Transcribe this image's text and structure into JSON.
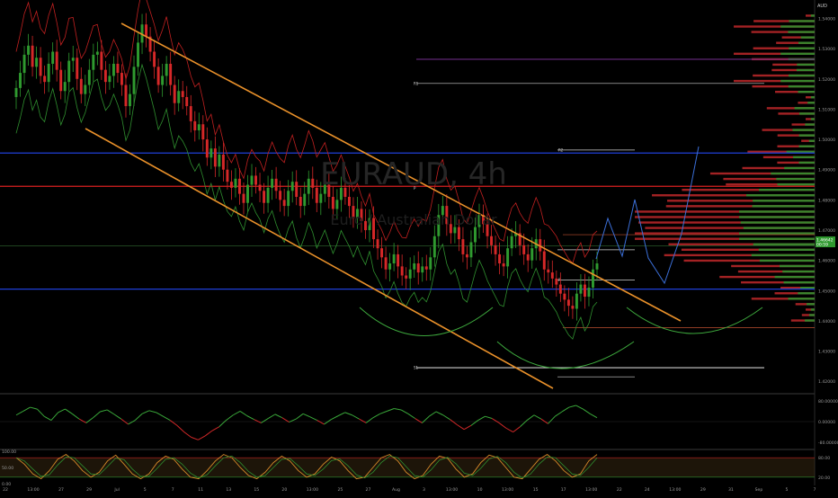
{
  "chart_data": [
    {
      "type": "candlestick",
      "symbol": "EURAUD, 4h",
      "description": "Euro / Australian Dollar",
      "currency": "AUD",
      "x_ticks": [
        "22",
        "13:00",
        "27",
        "29",
        "Jul",
        "5",
        "7",
        "11",
        "13",
        "15",
        "20",
        "13:00",
        "25",
        "27",
        "Aug",
        "3",
        "13:00",
        "10",
        "13:00",
        "15",
        "17",
        "13:00",
        "22",
        "24",
        "13:00",
        "29",
        "31",
        "Sep",
        "5",
        "7"
      ],
      "y_ticks": [
        "1.54000",
        "1.53000",
        "1.52000",
        "1.51000",
        "1.50000",
        "1.49000",
        "1.48000",
        "1.47000",
        "1.46000",
        "1.45000",
        "1.44000",
        "1.43000",
        "1.42000"
      ],
      "ylim": [
        1.4165,
        1.5455
      ],
      "last_price": "1.46642",
      "last_price_sub": "00:59",
      "series_close": [
        1.517,
        1.522,
        1.528,
        1.531,
        1.524,
        1.527,
        1.521,
        1.519,
        1.525,
        1.529,
        1.523,
        1.516,
        1.519,
        1.526,
        1.527,
        1.52,
        1.515,
        1.518,
        1.523,
        1.528,
        1.529,
        1.523,
        1.519,
        1.521,
        1.525,
        1.522,
        1.518,
        1.511,
        1.515,
        1.524,
        1.532,
        1.538,
        1.534,
        1.529,
        1.524,
        1.518,
        1.521,
        1.525,
        1.518,
        1.512,
        1.516,
        1.514,
        1.511,
        1.506,
        1.503,
        1.505,
        1.5,
        1.494,
        1.497,
        1.491,
        1.495,
        1.49,
        1.486,
        1.484,
        1.487,
        1.482,
        1.479,
        1.485,
        1.488,
        1.485,
        1.483,
        1.479,
        1.484,
        1.487,
        1.483,
        1.48,
        1.478,
        1.483,
        1.486,
        1.481,
        1.478,
        1.482,
        1.487,
        1.484,
        1.479,
        1.482,
        1.485,
        1.481,
        1.477,
        1.48,
        1.484,
        1.481,
        1.478,
        1.474,
        1.477,
        1.473,
        1.47,
        1.474,
        1.467,
        1.464,
        1.461,
        1.457,
        1.459,
        1.462,
        1.458,
        1.455,
        1.454,
        1.457,
        1.459,
        1.456,
        1.458,
        1.457,
        1.461,
        1.468,
        1.475,
        1.478,
        1.472,
        1.469,
        1.471,
        1.467,
        1.462,
        1.461,
        1.466,
        1.471,
        1.475,
        1.472,
        1.468,
        1.465,
        1.462,
        1.459,
        1.458,
        1.464,
        1.468,
        1.469,
        1.465,
        1.462,
        1.46,
        1.464,
        1.467,
        1.463,
        1.457,
        1.456,
        1.454,
        1.452,
        1.449,
        1.447,
        1.445,
        1.444,
        1.449,
        1.452,
        1.448,
        1.451,
        1.457,
        1.459
      ],
      "lines": [
        {
          "name": "resistance",
          "color": "#d92020",
          "price": 1.4845
        },
        {
          "name": "support",
          "color": "#1f3fd8",
          "price": 1.4505
        },
        {
          "name": "upper",
          "color": "#1f3fd8",
          "price": 1.4955
        },
        {
          "name": "R2",
          "color": "#6a2a80",
          "price": 1.5265
        },
        {
          "name": "S1",
          "color": "#cccccc",
          "price": 1.4245
        }
      ],
      "level_labels": [
        "R1",
        "R2",
        "P",
        "S1",
        "P"
      ],
      "channel_color": "#e8902a",
      "forecast_color": "#3b6fd8",
      "arc_color": "#3da83d"
    },
    {
      "type": "line",
      "name": "RSI",
      "y_ticks": [
        "80.00000",
        "0.00000",
        "-80.00000"
      ],
      "ylim": [
        -100,
        100
      ],
      "values": [
        25,
        40,
        55,
        48,
        20,
        5,
        35,
        48,
        30,
        10,
        -5,
        15,
        38,
        45,
        28,
        10,
        -10,
        5,
        30,
        42,
        35,
        20,
        5,
        -15,
        -40,
        -60,
        -70,
        -55,
        -35,
        -20,
        5,
        25,
        40,
        22,
        8,
        -5,
        12,
        28,
        15,
        -2,
        10,
        30,
        18,
        5,
        -10,
        8,
        22,
        35,
        25,
        10,
        -5,
        15,
        30,
        40,
        50,
        45,
        30,
        12,
        -5,
        20,
        38,
        25,
        8,
        -12,
        -30,
        -15,
        5,
        20,
        12,
        -5,
        -25,
        -40,
        -20,
        5,
        25,
        10,
        -8,
        20,
        38,
        55,
        62,
        48,
        30,
        15
      ]
    },
    {
      "type": "line",
      "name": "Stochastic",
      "y_ticks": [
        "100.00",
        "50.00",
        "0.00"
      ],
      "right_ticks": [
        "80.00",
        "20.00"
      ],
      "ylim": [
        0,
        100
      ],
      "k": [
        80,
        60,
        30,
        15,
        40,
        75,
        90,
        70,
        40,
        20,
        35,
        70,
        88,
        60,
        30,
        15,
        30,
        65,
        85,
        75,
        45,
        20,
        15,
        40,
        70,
        90,
        80,
        50,
        25,
        15,
        35,
        65,
        85,
        70,
        40,
        20,
        30,
        60,
        82,
        70,
        40,
        15,
        20,
        50,
        80,
        90,
        70,
        35,
        15,
        25,
        60,
        85,
        78,
        45,
        20,
        30,
        65,
        88,
        80,
        50,
        20,
        15,
        45,
        75,
        90,
        70,
        40,
        20,
        30,
        70,
        90
      ]
    }
  ]
}
